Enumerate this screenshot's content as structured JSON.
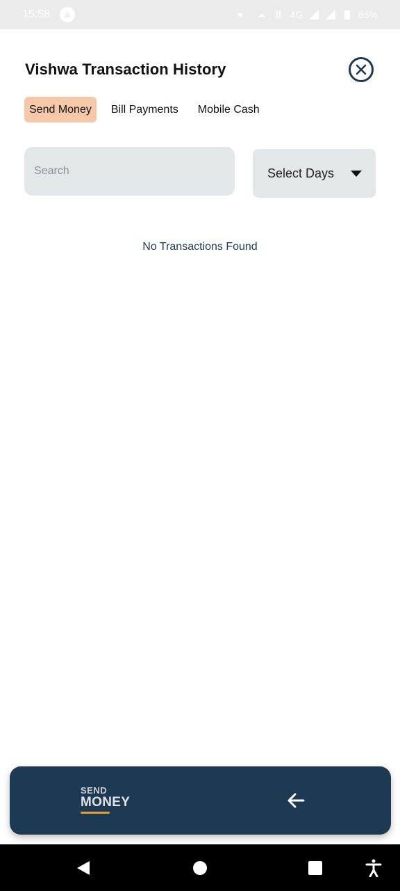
{
  "status_bar": {
    "time": "15:58",
    "network": "4G",
    "battery": "65%"
  },
  "header": {
    "title": "Vishwa Transaction History",
    "close_icon": "close-circle-icon"
  },
  "tabs": [
    {
      "label": "Send Money",
      "active": true
    },
    {
      "label": "Bill Payments",
      "active": false
    },
    {
      "label": "Mobile Cash",
      "active": false
    }
  ],
  "search": {
    "placeholder": "Search",
    "value": ""
  },
  "filter": {
    "select_label": "Select Days"
  },
  "empty_state": {
    "message": "No Transactions Found"
  },
  "bottom_bar": {
    "logo_line1": "SEND",
    "logo_line2": "MONEY",
    "back_icon": "arrow-left-icon"
  },
  "colors": {
    "primary": "#1e3a52",
    "active_tab": "#f4c8a8",
    "input_bg": "#e4e7e8",
    "logo_accent": "#e0a030"
  }
}
